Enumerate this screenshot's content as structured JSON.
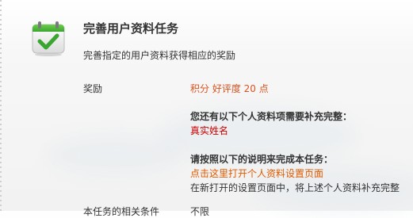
{
  "task": {
    "title": "完善用户资料任务",
    "description": "完善指定的用户资料获得相应的奖励"
  },
  "reward": {
    "label": "奖励",
    "value": "积分 好评度 20 点"
  },
  "requirements": {
    "title": "您还有以下个人资料项需要补充完整：",
    "items": [
      "真实姓名"
    ]
  },
  "instructions": {
    "title": "请按照以下的说明来完成本任务：",
    "link_text": "点击这里打开个人资料设置页面",
    "note": "在新打开的设置页面中，将上述个人资料补充完整"
  },
  "partial_row": {
    "label": "本任务的相关条件",
    "value": "不限"
  },
  "colors": {
    "reward": "#d9531e",
    "required_item": "#cc0000",
    "link": "#e05a00",
    "icon_green": "#3aa52f"
  },
  "icons": {
    "task_icon": "checked-calendar-icon"
  }
}
